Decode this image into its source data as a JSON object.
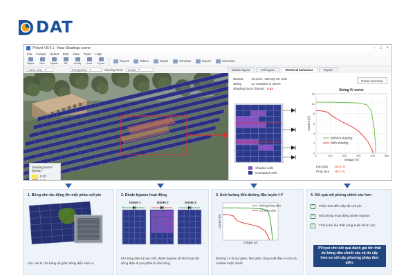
{
  "logo": {
    "text": "DAT"
  },
  "window": {
    "title": "PVsyst V8.0.1 - Near Shadings scene",
    "menu": [
      "File",
      "Create",
      "Select",
      "Edit",
      "View",
      "Tools",
      "Help"
    ],
    "toolbar": [
      "Object",
      "New",
      "Update",
      "Bill",
      "Modify",
      "Solve",
      "Export"
    ],
    "toolbar_wide": [
      "Report",
      "Tables",
      "Graph",
      "Simulate",
      "Export",
      "Calculate"
    ],
    "options": {
      "view_select": "Active view",
      "projection": "Perspective",
      "shading_mode": "Shading factor",
      "scale": "Linear"
    },
    "tabs": [
      "Module layout",
      "Cell layout",
      "Electrical behaviour",
      "Export"
    ],
    "active_tab": 2
  },
  "shading_legend": {
    "title": "Shading factor (linear)",
    "levels": [
      {
        "value": "0.20",
        "color": "#f4e84a"
      },
      {
        "value": "0.15",
        "color": "#f0a43a"
      },
      {
        "value": "0.10",
        "color": "#e2603a"
      },
      {
        "value": "0.05",
        "color": "#b63a7e"
      },
      {
        "value": "0.00",
        "color": "#3b2fa6"
      }
    ]
  },
  "panel": {
    "module_label": "Module",
    "module_value": "Generic, 330 Wp 60 cells",
    "string_label": "String",
    "string_value": "12 modules in series",
    "shading_label": "Shading factor (linear)",
    "shading_value": "0.32",
    "reset_button": "Reset overview",
    "shaded_cells": "Shaded cells",
    "unshaded_cells": "Unshaded cells",
    "imp_label": "Imp loss",
    "imp_value": "-28.4 %",
    "pmp_label": "Pmp loss",
    "pmp_value": "-35.7 %"
  },
  "colors": {
    "shaded": "#8a4fc2",
    "unshaded": "#2d3a8c",
    "without_shading": "#6cbf4a",
    "with_shading": "#e33d3d",
    "accent": "#20457f"
  },
  "chart_data": [
    {
      "type": "line",
      "title": "String IV curve",
      "xlabel": "Voltage [V]",
      "ylabel": "Current [A]",
      "xlim": [
        0,
        500
      ],
      "ylim": [
        0,
        12
      ],
      "xticks": [
        0,
        100,
        200,
        300,
        400,
        500
      ],
      "yticks": [
        0,
        2,
        4,
        6,
        8,
        10,
        12
      ],
      "legend_position": "bottom-left",
      "series": [
        {
          "name": "Without shading",
          "color": "#6cbf4a",
          "x": [
            0,
            100,
            200,
            300,
            360,
            390,
            410,
            420,
            425
          ],
          "y": [
            10.3,
            10.3,
            10.25,
            10.15,
            9.8,
            8.6,
            5.5,
            2.0,
            0
          ]
        },
        {
          "name": "With shading",
          "color": "#e33d3d",
          "x": [
            0,
            40,
            80,
            110,
            150,
            200,
            250,
            300,
            340,
            370,
            395,
            405
          ],
          "y": [
            8.6,
            8.55,
            8.3,
            7.6,
            6.9,
            6.1,
            5.4,
            4.5,
            3.3,
            2.2,
            0.8,
            0
          ]
        }
      ]
    },
    {
      "type": "line",
      "title": "",
      "xlabel": "Voltage [V]",
      "ylabel": "Current [A]",
      "xlim": [
        0,
        420
      ],
      "ylim": [
        0,
        12
      ],
      "legend_position": "top-right",
      "series": [
        {
          "name": "Không bóng râm",
          "color": "#3ea43e",
          "x": [
            0,
            100,
            200,
            300,
            340,
            360,
            372,
            378
          ],
          "y": [
            10.4,
            10.4,
            10.3,
            10.1,
            9.4,
            7.2,
            3.0,
            0
          ]
        },
        {
          "name": "Có bóng râm",
          "color": "#e33d3d",
          "x": [
            0,
            40,
            80,
            110,
            160,
            220,
            280,
            320,
            345,
            355
          ],
          "y": [
            8.3,
            8.2,
            7.8,
            6.2,
            5.5,
            4.9,
            4.2,
            3.0,
            1.2,
            0
          ]
        }
      ]
    }
  ],
  "cards": [
    {
      "title": "1. Bóng râm tác động lên một phần cell pin",
      "text": "Các cell bị che bóng sẽ giảm dòng điện sinh ra."
    },
    {
      "title": "2. Diode bypass hoạt động",
      "diodes": [
        "Diode 1",
        "Diode 2",
        "Diode 3"
      ],
      "text": "Khi dòng điện bị hạn chế, diode bypass sẽ kích hoạt để dòng điện đi qua phần bị che bóng."
    },
    {
      "title": "3. Ảnh hưởng đến đường đặc tuyến I-V",
      "text": "Đường I-V bị sụt giảm, làm giảm công suất đầu ra của cả module hoặc chuỗi."
    },
    {
      "title": "4. Kết quả mô phỏng chính xác hơn",
      "checks": [
        "Phân tích đến cấp độ cell pin",
        "Mô phỏng hoạt động diode bypass",
        "Tính toán tổn thất công suất chính xác"
      ],
      "summary": "PVsyst cho kết quả đánh giá tổn thất do bóng râm chính xác và tin cậy hơn so với các phương pháp đơn giản."
    }
  ]
}
